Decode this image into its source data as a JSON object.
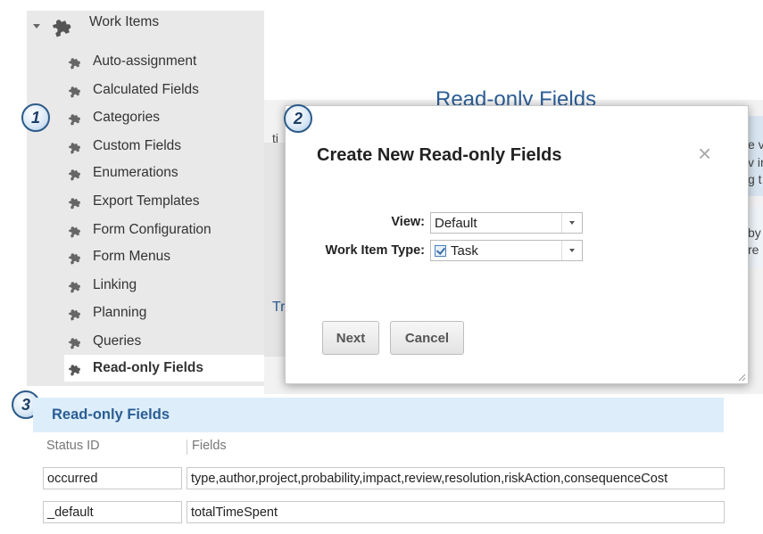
{
  "sidebar": {
    "root": {
      "label": "Work Items",
      "icon": "puzzle-icon"
    },
    "items": [
      {
        "label": "Auto-assignment",
        "icon": "puzzle-icon"
      },
      {
        "label": "Calculated Fields",
        "icon": "puzzle-icon"
      },
      {
        "label": "Categories",
        "icon": "puzzle-icon"
      },
      {
        "label": "Custom Fields",
        "icon": "puzzle-icon"
      },
      {
        "label": "Enumerations",
        "icon": "puzzle-icon"
      },
      {
        "label": "Export Templates",
        "icon": "puzzle-icon"
      },
      {
        "label": "Form Configuration",
        "icon": "puzzle-icon"
      },
      {
        "label": "Form Menus",
        "icon": "puzzle-icon"
      },
      {
        "label": "Linking",
        "icon": "puzzle-icon"
      },
      {
        "label": "Planning",
        "icon": "puzzle-icon"
      },
      {
        "label": "Queries",
        "icon": "puzzle-icon"
      },
      {
        "label": "Read-only Fields",
        "icon": "puzzle-icon",
        "active": true
      }
    ]
  },
  "background": {
    "title": "Read-only Fields",
    "frag_left_1": "ti",
    "frag_left_2": "Tr",
    "frag_right_1": "e v",
    "frag_right_2": "v ir",
    "frag_right_3": "g t",
    "frag_right_4": "by",
    "frag_right_5": "re"
  },
  "dialog": {
    "title": "Create New Read-only Fields",
    "close_symbol": "×",
    "view_label": "View:",
    "view_value": "Default",
    "type_label": "Work Item Type:",
    "type_value": "Task",
    "next_label": "Next",
    "cancel_label": "Cancel"
  },
  "callouts": {
    "one": "1",
    "two": "2",
    "three": "3"
  },
  "table": {
    "title": "Read-only Fields",
    "headers": {
      "status": "Status ID",
      "fields": "Fields"
    },
    "rows": [
      {
        "status": "occurred",
        "fields": "type,author,project,probability,impact,review,resolution,riskAction,consequenceCost"
      },
      {
        "status": "_default",
        "fields": "totalTimeSpent"
      }
    ]
  },
  "colors": {
    "accent_blue": "#2b5d94",
    "section_header_bg": "#ddeefa",
    "sidebar_bg": "#e9e9e9",
    "badge_border": "#2c5a88"
  }
}
